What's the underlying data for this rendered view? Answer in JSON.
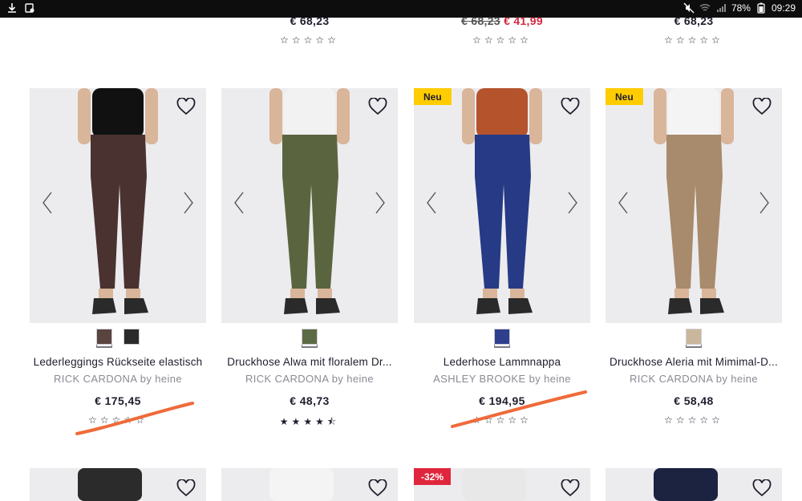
{
  "status_bar": {
    "battery": "78%",
    "time": "09:29"
  },
  "top_row": [
    {
      "price": "€ 68,23",
      "old_price": "",
      "sale_price": "",
      "stars": "☆☆☆☆☆"
    },
    {
      "price": "",
      "old_price": "€ 68,23",
      "sale_price": "€ 41,99",
      "stars": "☆☆☆☆☆"
    },
    {
      "price": "€ 68,23",
      "old_price": "",
      "sale_price": "",
      "stars": "☆☆☆☆☆"
    }
  ],
  "products": [
    {
      "badge": "",
      "name": "Lederleggings Rückseite elastisch",
      "brand": "RICK CARDONA by heine",
      "price": "€ 175,45",
      "stars": "☆☆☆☆☆",
      "rating": 0,
      "swatches": [
        "#5a4440",
        "#2a2a2a"
      ],
      "pants_color": "#4a3230"
    },
    {
      "badge": "",
      "name": "Druckhose Alwa mit floralem Dr...",
      "brand": "RICK CARDONA by heine",
      "price": "€ 48,73",
      "stars": "★★★★⯪",
      "rating": 4.5,
      "swatches": [
        "#5d6b45"
      ],
      "pants_color": "#5a6540"
    },
    {
      "badge": "Neu",
      "name": "Lederhose Lammnappa",
      "brand": "ASHLEY BROOKE by heine",
      "price": "€ 194,95",
      "stars": "☆☆☆☆☆",
      "rating": 0,
      "swatches": [
        "#2f3f8e"
      ],
      "pants_color": "#263a86"
    },
    {
      "badge": "Neu",
      "name": "Druckhose Aleria mit Mimimal-D...",
      "brand": "RICK CARDONA by heine",
      "price": "€ 58,48",
      "stars": "☆☆☆☆☆",
      "rating": 0,
      "swatches": [
        "#c9b69b"
      ],
      "pants_color": "#a88a6c"
    }
  ],
  "bottom_row": [
    {
      "badge": ""
    },
    {
      "badge": ""
    },
    {
      "badge": "-32%"
    },
    {
      "badge": ""
    }
  ],
  "colors": {
    "sale_red": "#d0283d",
    "badge_yellow": "#ffcc00",
    "text_dark": "#1e1e2e",
    "brand_gray": "#8a8a95",
    "markup_orange": "#f06a3a"
  }
}
